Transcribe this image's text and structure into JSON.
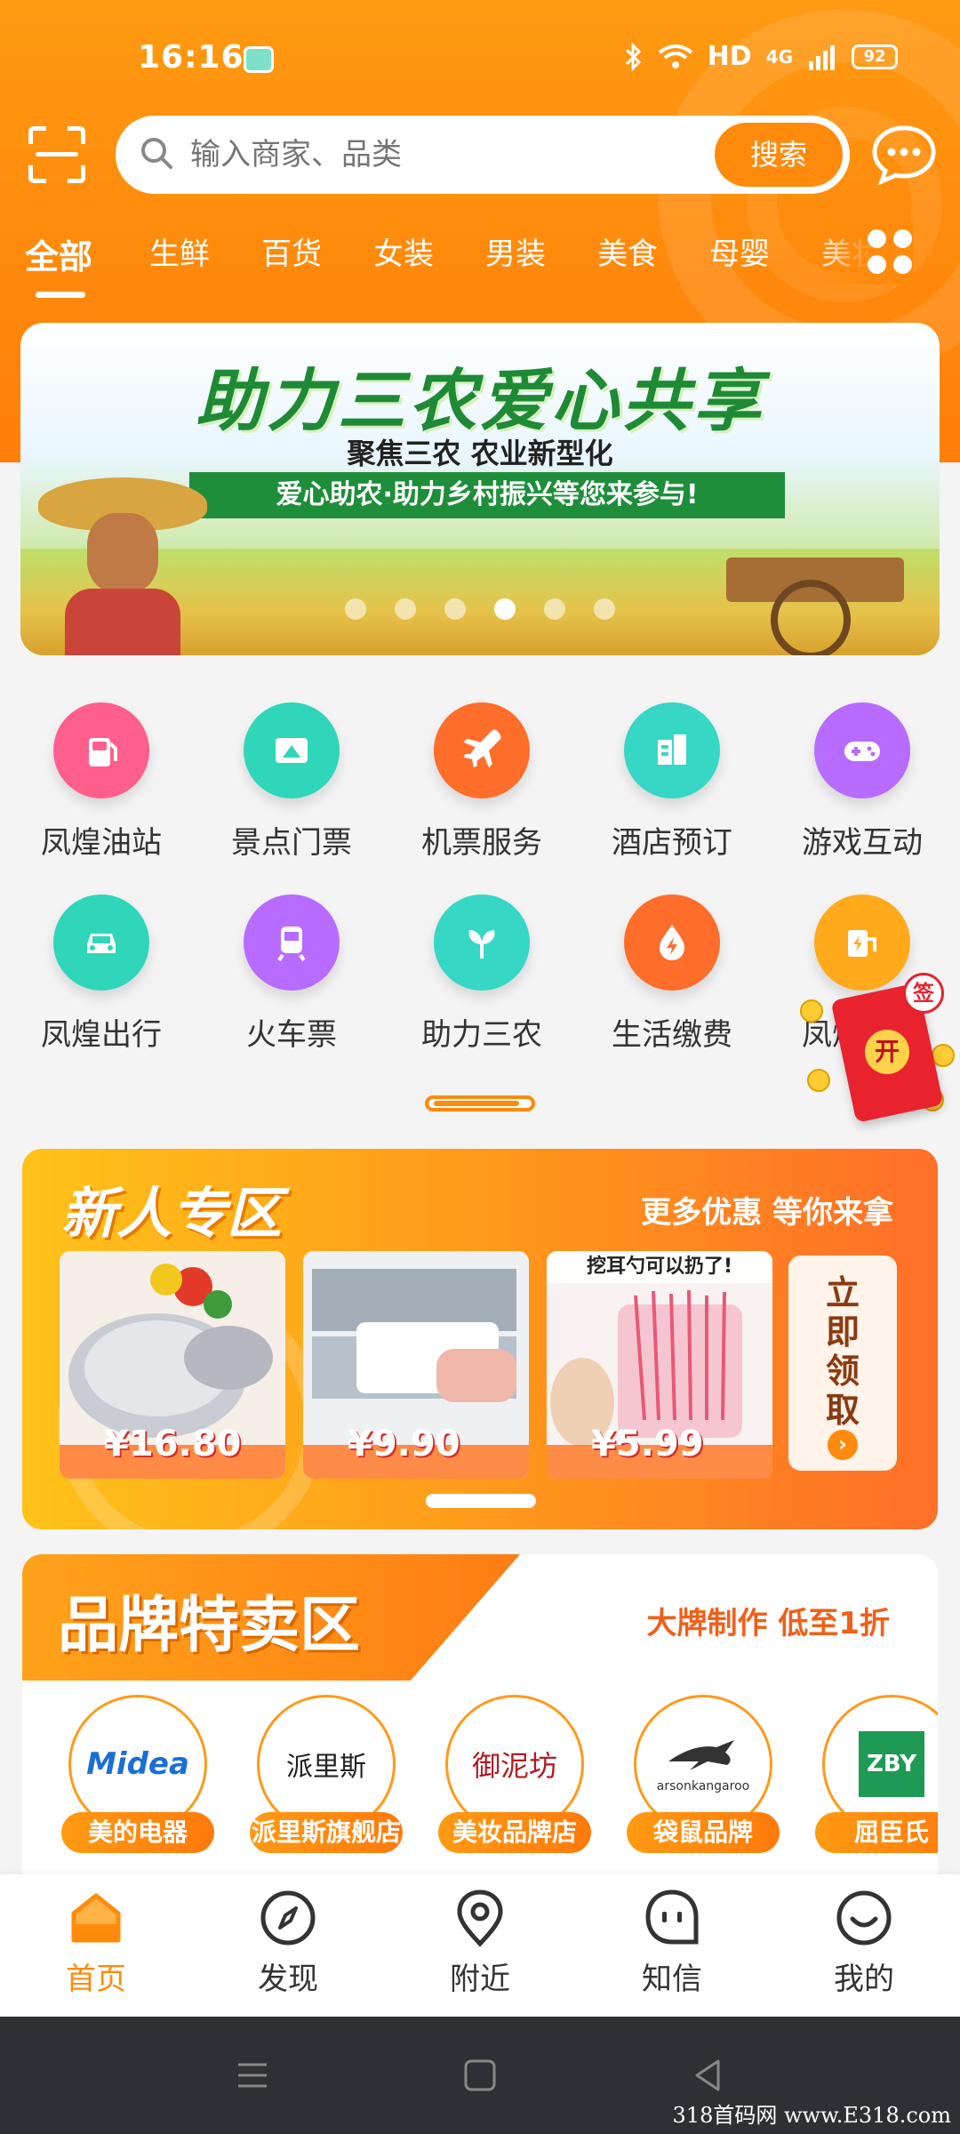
{
  "status_bar": {
    "time": "16:16",
    "network": "HD",
    "signal": "4G",
    "battery": "92"
  },
  "search": {
    "placeholder": "输入商家、品类",
    "button": "搜索"
  },
  "categories": {
    "items": [
      "全部",
      "生鲜",
      "百货",
      "女装",
      "男装",
      "美食",
      "母婴",
      "美妆"
    ],
    "active": "全部",
    "more_icon": "grid-icon"
  },
  "banner": {
    "title": "助力三农爱心共享",
    "subtitle": "聚焦三农  农业新型化",
    "ribbon": "爱心助农·助力乡村振兴等您来参与!",
    "page_count": 6,
    "active_page": 4
  },
  "services": [
    {
      "label": "凤煌油站",
      "icon": "gas-station-icon",
      "color": "#ff5f8c"
    },
    {
      "label": "景点门票",
      "icon": "ticket-icon",
      "color": "#2fd6b9"
    },
    {
      "label": "机票服务",
      "icon": "airplane-icon",
      "color": "#ff6d2b"
    },
    {
      "label": "酒店预订",
      "icon": "hotel-icon",
      "color": "#36d7c5"
    },
    {
      "label": "游戏互动",
      "icon": "gamepad-icon",
      "color": "#b76cff"
    },
    {
      "label": "凤煌出行",
      "icon": "car-icon",
      "color": "#2fd6b9"
    },
    {
      "label": "火车票",
      "icon": "train-icon",
      "color": "#b76cff"
    },
    {
      "label": "助力三农",
      "icon": "sprout-icon",
      "color": "#36d7c5"
    },
    {
      "label": "生活缴费",
      "icon": "utility-icon",
      "color": "#ff6d2b"
    },
    {
      "label": "凤煌充电",
      "icon": "charging-icon",
      "color": "#ffaa1a"
    }
  ],
  "redpacket": {
    "open": "开",
    "sign": "签"
  },
  "newcomer": {
    "title": "新人专区",
    "subtitle": "更多优惠 等你来拿",
    "products": [
      {
        "price": "¥16.80",
        "top_text": ""
      },
      {
        "price": "¥9.90",
        "top_text": ""
      },
      {
        "price": "¥5.99",
        "top_text": "挖耳勺可以扔了!"
      }
    ],
    "claim": "立即领取"
  },
  "brand_zone": {
    "title": "品牌特卖区",
    "subtitle": "大牌制作 低至1折",
    "brands": [
      {
        "logo": "Midea",
        "name": "美的电器"
      },
      {
        "logo": "派里斯",
        "name": "派里斯旗舰店"
      },
      {
        "logo": "御泥坊",
        "name": "美妆品牌店"
      },
      {
        "logo": "arsonkangaroo",
        "name": "袋鼠品牌"
      },
      {
        "logo": "ZBY",
        "name": "屈臣氏"
      }
    ]
  },
  "bottom_nav": [
    {
      "label": "首页",
      "icon": "home-icon",
      "active": true
    },
    {
      "label": "发现",
      "icon": "compass-icon",
      "active": false
    },
    {
      "label": "附近",
      "icon": "location-icon",
      "active": false
    },
    {
      "label": "知信",
      "icon": "chat-icon",
      "active": false
    },
    {
      "label": "我的",
      "icon": "profile-icon",
      "active": false
    }
  ],
  "watermark": "318首码网 www.E318.com",
  "colors": {
    "brand": "#ff8a0c",
    "text": "#333333"
  }
}
